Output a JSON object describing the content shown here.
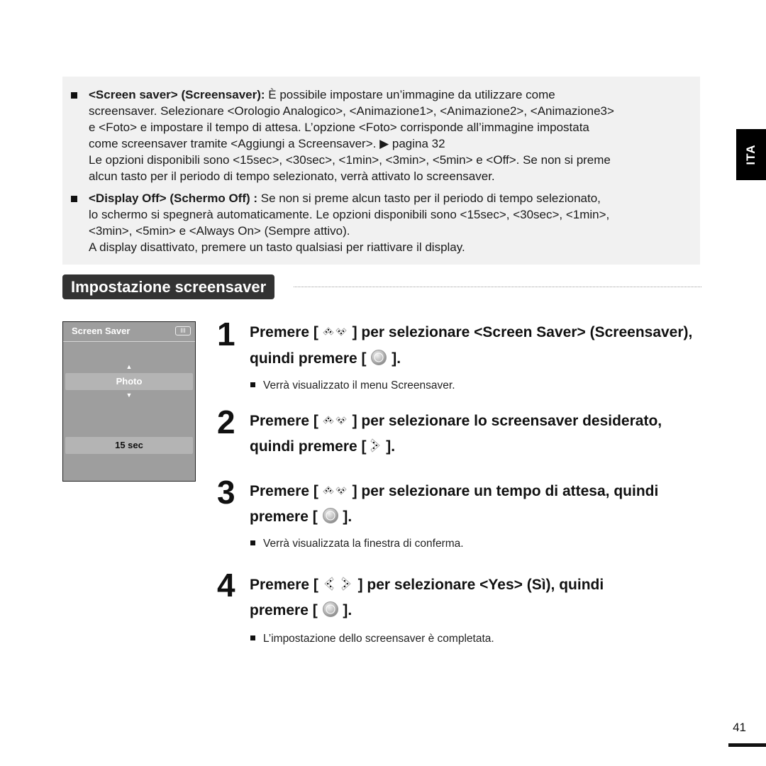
{
  "side_tab": {
    "label": "ITA"
  },
  "info_box": {
    "items": [
      {
        "bold": "<Screen saver> (Screensaver):",
        "lines": [
          " È possibile impostare un’immagine da utilizzare come",
          "screensaver. Selezionare <Orologio Analogico>, <Animazione1>, <Animazione2>, <Animazione3>",
          "e <Foto> e impostare il tempo di attesa. L’opzione <Foto> corrisponde all’immagine impostata",
          "come screensaver tramite <Aggiungi a Screensaver>. ▶ pagina 32",
          "Le opzioni disponibili sono <15sec>, <30sec>, <1min>, <3min>, <5min> e <Off>. Se non si preme",
          "alcun tasto per il periodo di tempo selezionato, verrà attivato lo screensaver."
        ]
      },
      {
        "bold": "<Display Off> (Schermo Off) :",
        "lines": [
          " Se non si preme alcun tasto per il periodo di tempo selezionato,",
          "lo schermo si spegnerà automaticamente. Le opzioni disponibili sono <15sec>, <30sec>, <1min>,",
          "<3min>, <5min> e <Always On> (Sempre attivo).",
          "A display disattivato, premere un tasto qualsiasi per riattivare il display."
        ]
      }
    ]
  },
  "section": {
    "title": "Impostazione screensaver"
  },
  "device_screen": {
    "title": "Screen Saver",
    "battery_icon": "battery-icon",
    "selected_option": "Photo",
    "time_value": "15 sec"
  },
  "steps": [
    {
      "number": "1",
      "line1_pre": "Premere [",
      "icon1": "up-down-keys-icon",
      "line1_post": "] per selezionare <Screen Saver> (Screensaver),",
      "line2_pre": "quindi premere [",
      "icon2": "select-button-icon",
      "line2_post": "].",
      "note": "Verrà visualizzato il menu Screensaver."
    },
    {
      "number": "2",
      "line1_pre": "Premere [",
      "icon1": "up-down-keys-icon",
      "line1_post": "] per selezionare lo screensaver desiderato,",
      "line2_pre": "quindi premere [",
      "icon2": "right-key-icon",
      "line2_post": "]."
    },
    {
      "number": "3",
      "line1_pre": "Premere [",
      "icon1": "up-down-keys-icon",
      "line1_post": "] per selezionare un tempo di attesa, quindi",
      "line2_pre": "premere [",
      "icon2": "select-button-icon",
      "line2_post": "].",
      "note": "Verrà visualizzata la finestra di conferma."
    },
    {
      "number": "4",
      "line1_pre": "Premere [",
      "icon1": "left-right-keys-icon",
      "line1_post": "] per selezionare <Yes> (Sì),  quindi",
      "line2_pre": "premere [",
      "icon2": "select-button-icon",
      "line2_post": "].",
      "note": "L’impostazione dello screensaver è completata."
    }
  ],
  "footer": {
    "page_number": "41"
  }
}
